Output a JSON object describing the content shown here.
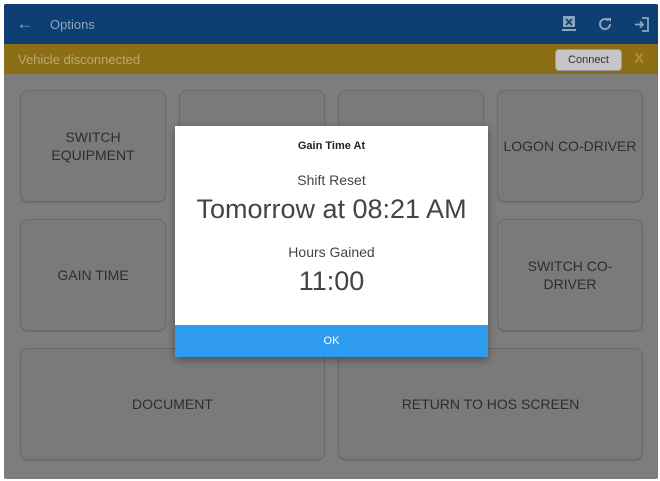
{
  "appbar": {
    "back_icon": "arrow-left-icon",
    "title": "Options",
    "actions": [
      "disconnect-device-icon",
      "refresh-icon",
      "logout-icon"
    ]
  },
  "banner": {
    "text": "Vehicle disconnected",
    "connect_label": "Connect",
    "close_label": "X"
  },
  "tiles": {
    "switch_equipment": "SWITCH EQUIPMENT",
    "logon_co_driver": "LOGON CO-DRIVER",
    "gain_time": "GAIN TIME",
    "switch_co_driver": "SWITCH CO-DRIVER",
    "document": "DOCUMENT",
    "return_to_hos": "RETURN TO HOS SCREEN"
  },
  "dialog": {
    "title": "Gain Time At",
    "shift_reset_label": "Shift Reset",
    "shift_reset_value": "Tomorrow at 08:21 AM",
    "hours_gained_label": "Hours Gained",
    "hours_gained_value": "11:00",
    "ok_label": "OK"
  },
  "colors": {
    "appbar": "#0d3f72",
    "banner": "#8c6f14",
    "overlay": "#7d7d7d",
    "ok_button": "#2e9bef"
  }
}
